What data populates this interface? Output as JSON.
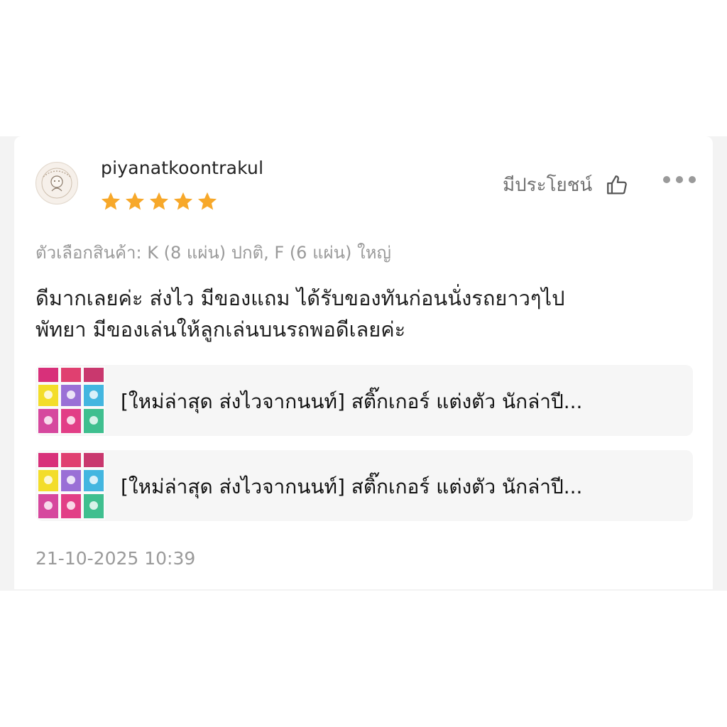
{
  "review": {
    "username": "piyanatkoontrakul",
    "rating": 5,
    "rating_max": 5,
    "helpful_label": "มีประโยชน์",
    "variation": "ตัวเลือกสินค้า: K (8 แผ่น) ปกติ, F (6 แผ่น) ใหญ่",
    "comment_lines": [
      "ดีมากเลยค่ะ ส่งไว มีของแถม ได้รับของทันก่อนนั่งรถยาวๆไป",
      "พัทยา มีของเล่นให้ลูกเล่นบนรถพอดีเลยค่ะ"
    ],
    "products": [
      {
        "title": "[ใหม่ล่าสุด ส่งไวจากนนท์] สติ๊กเกอร์ แต่งตัว นักล่าปี..."
      },
      {
        "title": "[ใหม่ล่าสุด ส่งไวจากนนท์] สติ๊กเกอร์ แต่งตัว นักล่าปี..."
      }
    ],
    "timestamp": "21-10-2025 10:39"
  },
  "icons": {
    "star": "star-icon",
    "thumb": "thumbs-up-icon",
    "more": "more-horizontal-icon"
  },
  "colors": {
    "star": "#f7a82a",
    "muted_text": "#9a9a9a",
    "card_bg": "#ffffff",
    "product_bg": "#f6f6f6"
  }
}
